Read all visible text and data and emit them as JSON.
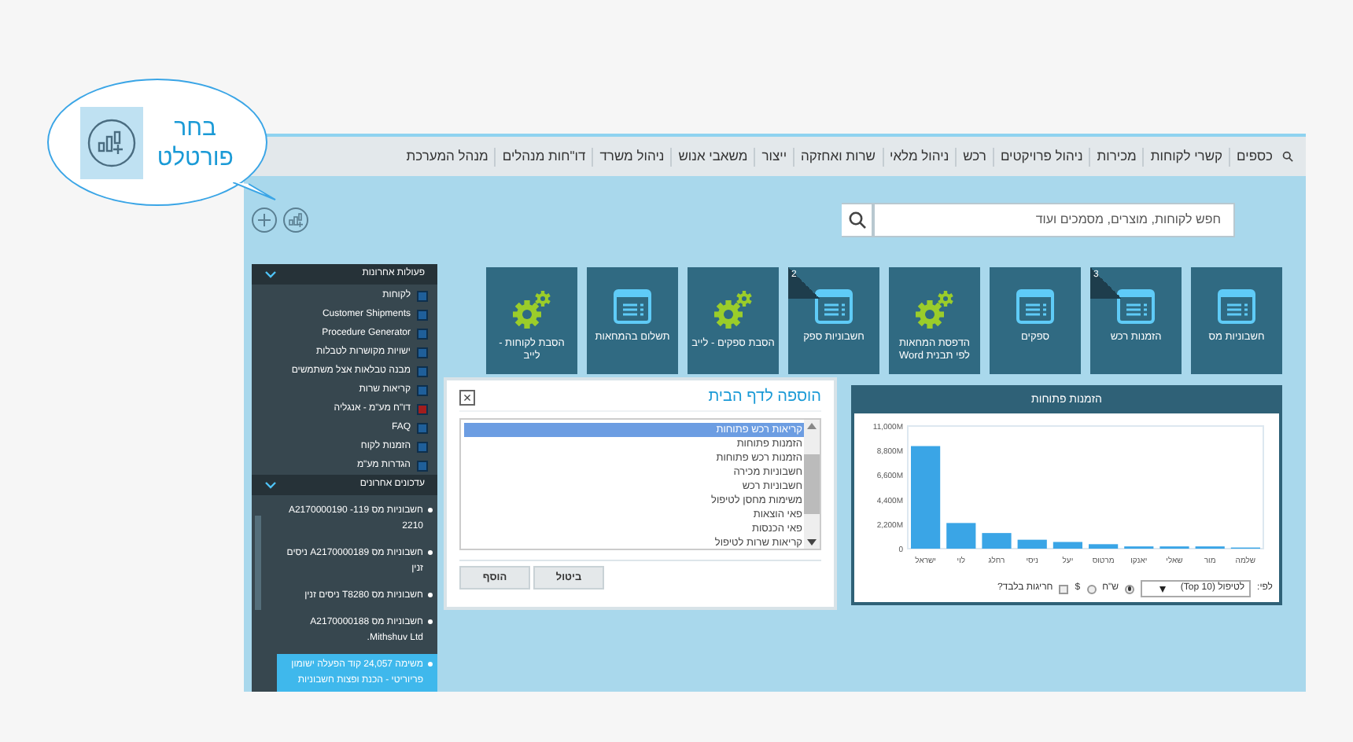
{
  "callout": {
    "text": "בחר פורטלט"
  },
  "menu": [
    {
      "label": "כספים"
    },
    {
      "label": "קשרי לקוחות"
    },
    {
      "label": "מכירות"
    },
    {
      "label": "ניהול פרויקטים"
    },
    {
      "label": "רכש"
    },
    {
      "label": "ניהול מלאי"
    },
    {
      "label": "שרות ואחזקה"
    },
    {
      "label": "ייצור"
    },
    {
      "label": "משאבי אנוש"
    },
    {
      "label": "ניהול משרד"
    },
    {
      "label": "דו\"חות מנהלים"
    },
    {
      "label": "מנהל המערכת"
    }
  ],
  "search": {
    "placeholder": "חפש לקוחות, מוצרים, מסמכים ועוד"
  },
  "recent_actions": {
    "title": "פעולות אחרונות",
    "expanded": true,
    "items": [
      {
        "label": "לקוחות",
        "kind": "form"
      },
      {
        "label": "Customer Shipments",
        "kind": "form"
      },
      {
        "label": "Procedure Generator",
        "kind": "form"
      },
      {
        "label": "ישויות מקושרות לטבלות",
        "kind": "form"
      },
      {
        "label": "מבנה טבלאות אצל משתמשים",
        "kind": "form"
      },
      {
        "label": "קריאות שרות",
        "kind": "form"
      },
      {
        "label": "דו\"ח מע\"מ - אנגליה",
        "kind": "report"
      },
      {
        "label": "FAQ",
        "kind": "form"
      },
      {
        "label": "הזמנות לקוח",
        "kind": "form"
      },
      {
        "label": "הגדרות מע\"מ",
        "kind": "form"
      }
    ]
  },
  "recent_updates": {
    "title": "עדכונים אחרונים",
    "expanded": true,
    "items": [
      {
        "label": "חשבוניות מס 119- A2170000190 2210",
        "selected": false
      },
      {
        "label": "חשבוניות מס A2170000189 ניסים זנין",
        "selected": false
      },
      {
        "label": "חשבוניות מס T8280 ניסים זנין",
        "selected": false
      },
      {
        "label": "חשבוניות מס A2170000188 Mithshuv Ltd.",
        "selected": false
      },
      {
        "label": "משימה 24,057 קוד הפעלה ישומון פריוריטי - הכנת ופצות חשבוניות",
        "selected": true
      }
    ]
  },
  "tiles": [
    {
      "label": "חשבוניות מס",
      "kind": "window"
    },
    {
      "label": "הזמנות רכש",
      "kind": "window",
      "badge": "3"
    },
    {
      "label": "ספקים",
      "kind": "window"
    },
    {
      "label": "הדפסת המחאות לפי תבנית Word",
      "kind": "gear"
    },
    {
      "label": "חשבוניות ספק",
      "kind": "window",
      "badge": "2"
    },
    {
      "label": "הסבת ספקים - לייב",
      "kind": "gear"
    },
    {
      "label": "תשלום בהמחאות",
      "kind": "window"
    },
    {
      "label": "הסבת לקוחות - לייב",
      "kind": "gear"
    }
  ],
  "dialog": {
    "title": "הוספה לדף הבית",
    "close": "×",
    "items": [
      {
        "label": "קריאות רכש פתוחות",
        "selected": true
      },
      {
        "label": "הזמנות פתוחות",
        "selected": false
      },
      {
        "label": "הזמנות רכש פתוחות",
        "selected": false
      },
      {
        "label": "חשבוניות מכירה",
        "selected": false
      },
      {
        "label": "חשבוניות רכש",
        "selected": false
      },
      {
        "label": "משימות מחסן לטיפול",
        "selected": false
      },
      {
        "label": "פאי הוצאות",
        "selected": false
      },
      {
        "label": "פאי הכנסות",
        "selected": false
      },
      {
        "label": "קריאות שרות לטיפול",
        "selected": false
      }
    ],
    "buttons": [
      {
        "label": "ביטול"
      },
      {
        "label": "הוסף"
      }
    ]
  },
  "chart_panel": {
    "title": "הזמנות פתוחות",
    "chart_data": {
      "type": "bar",
      "categories": [
        "ישראל",
        "לוי",
        "רחלג",
        "ניסי",
        "יעל",
        "מרטוס",
        "יאנקו",
        "שאלי",
        "מור",
        "שלמה"
      ],
      "series": [
        {
          "color": "#3aa5e6",
          "values": [
            9200,
            2300,
            1400,
            800,
            600,
            400,
            200,
            200,
            200,
            100
          ]
        }
      ],
      "ylim": [
        0,
        11000
      ],
      "yticks": [
        {
          "value": 0,
          "label": "0"
        },
        {
          "value": 2200,
          "label": "2,200M"
        },
        {
          "value": 4400,
          "label": "4,400M"
        },
        {
          "value": 6600,
          "label": "6,600M"
        },
        {
          "value": 8800,
          "label": "8,800M"
        },
        {
          "value": 11000,
          "label": "11,000M"
        }
      ]
    },
    "by_label": "לפי:",
    "dropdown": {
      "value": "לטיפול (Top 10)"
    },
    "currencies": [
      {
        "label": "ש\"ח",
        "selected": true
      },
      {
        "label": "$",
        "selected": false
      }
    ],
    "exceptions_only": {
      "label": "חריגות בלבד?",
      "checked": false
    }
  }
}
